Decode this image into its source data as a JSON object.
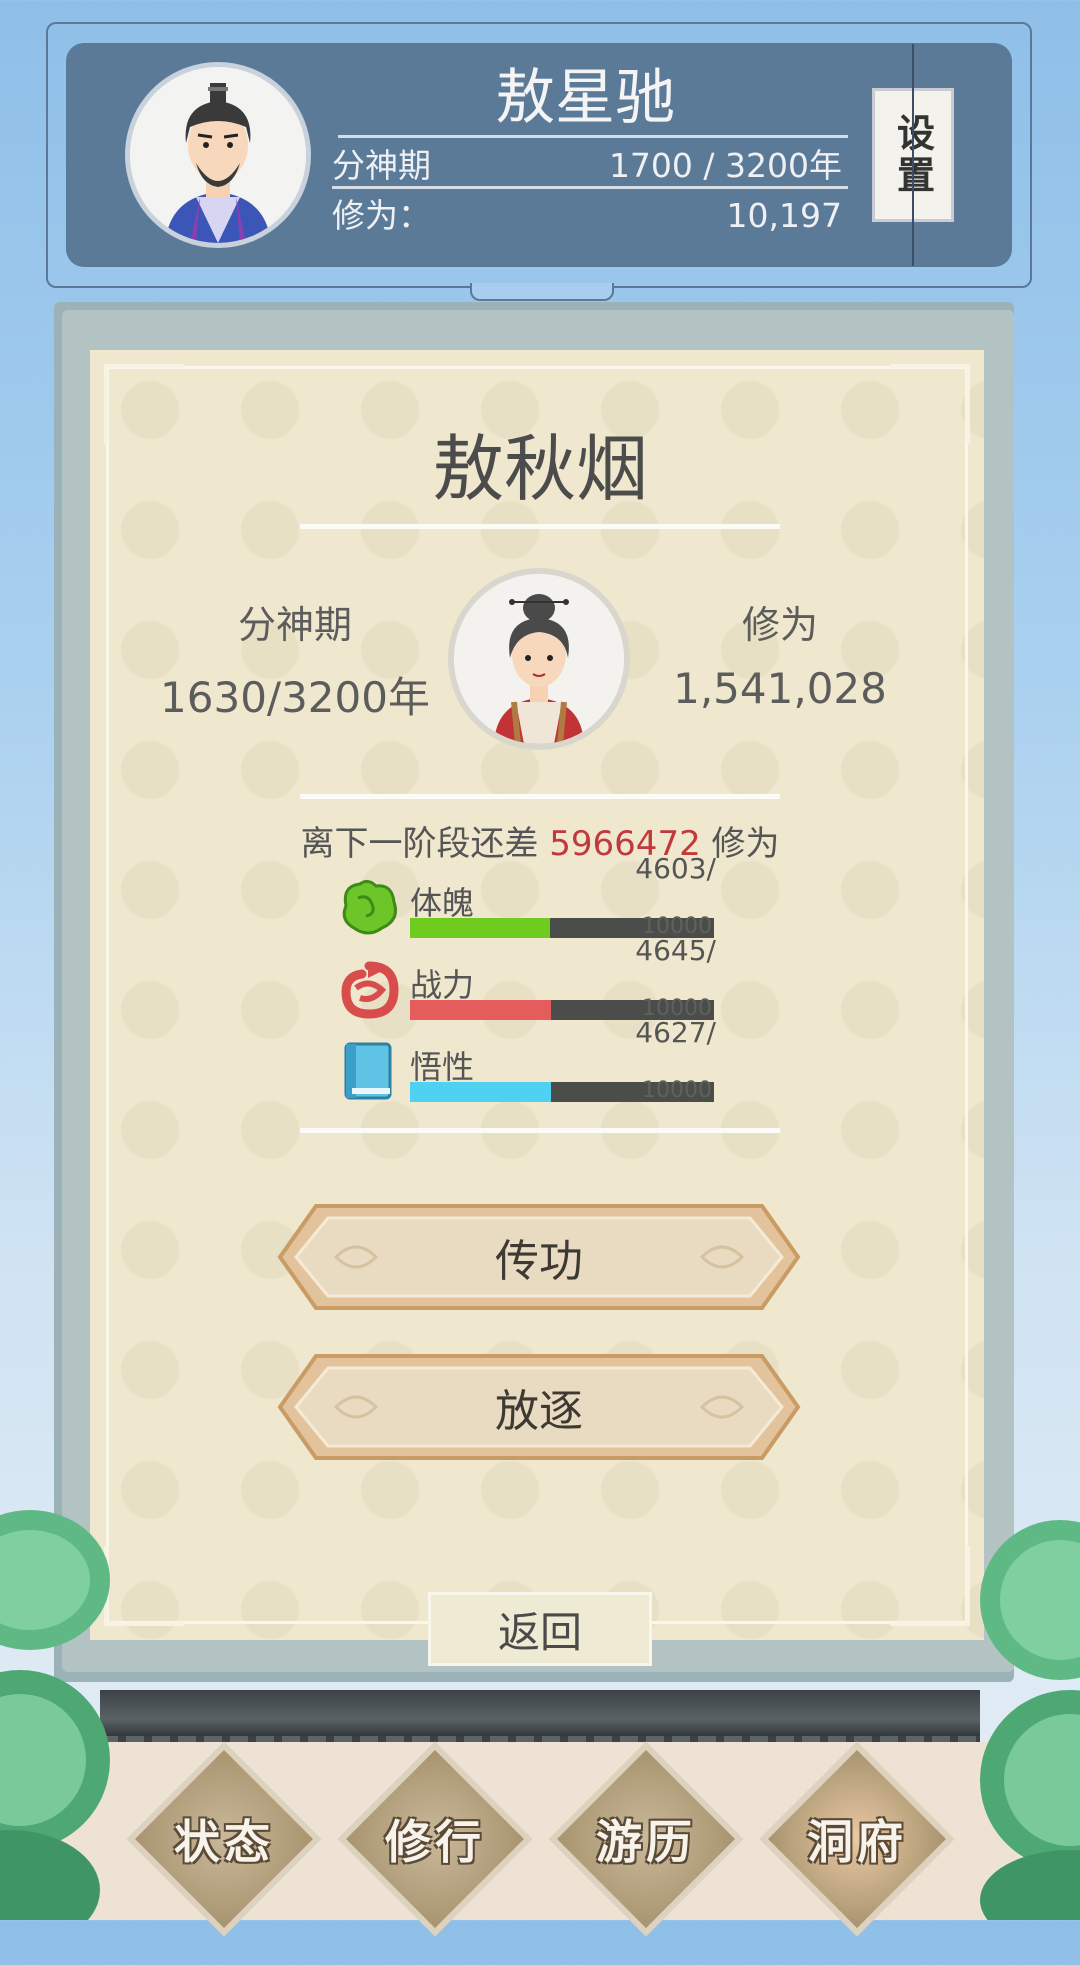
{
  "header": {
    "player_name": "敖星驰",
    "realm": "分神期",
    "age": "1700 / 3200年",
    "cultivation_label": "修为：",
    "cultivation_value": "10,197",
    "settings_label": "设置"
  },
  "member": {
    "name": "敖秋烟",
    "realm": "分神期",
    "age": "1630/3200年",
    "cultivation_label": "修为",
    "cultivation_value": "1,541,028",
    "next_stage_prefix": "离下一阶段还差",
    "next_stage_value": "5966472",
    "next_stage_suffix": "修为"
  },
  "attributes": [
    {
      "name": "体魄",
      "value": "4603/",
      "max": "10000",
      "fraction": 0.46,
      "color": "#6fcc1e",
      "icon": "body-icon"
    },
    {
      "name": "战力",
      "value": "4645/",
      "max": "10000",
      "fraction": 0.4645,
      "color": "#e55c5c",
      "icon": "dragon-icon"
    },
    {
      "name": "悟性",
      "value": "4627/",
      "max": "10000",
      "fraction": 0.4627,
      "color": "#4fd2f2",
      "icon": "book-icon"
    }
  ],
  "actions": {
    "transmit": "传功",
    "exile": "放逐",
    "back": "返回"
  },
  "nav": [
    {
      "label": "状态",
      "color": "#c9b89a"
    },
    {
      "label": "修行",
      "color": "#c9b89a"
    },
    {
      "label": "游历",
      "color": "#c9b89a"
    },
    {
      "label": "洞府",
      "color": "#e9c9a4"
    }
  ]
}
